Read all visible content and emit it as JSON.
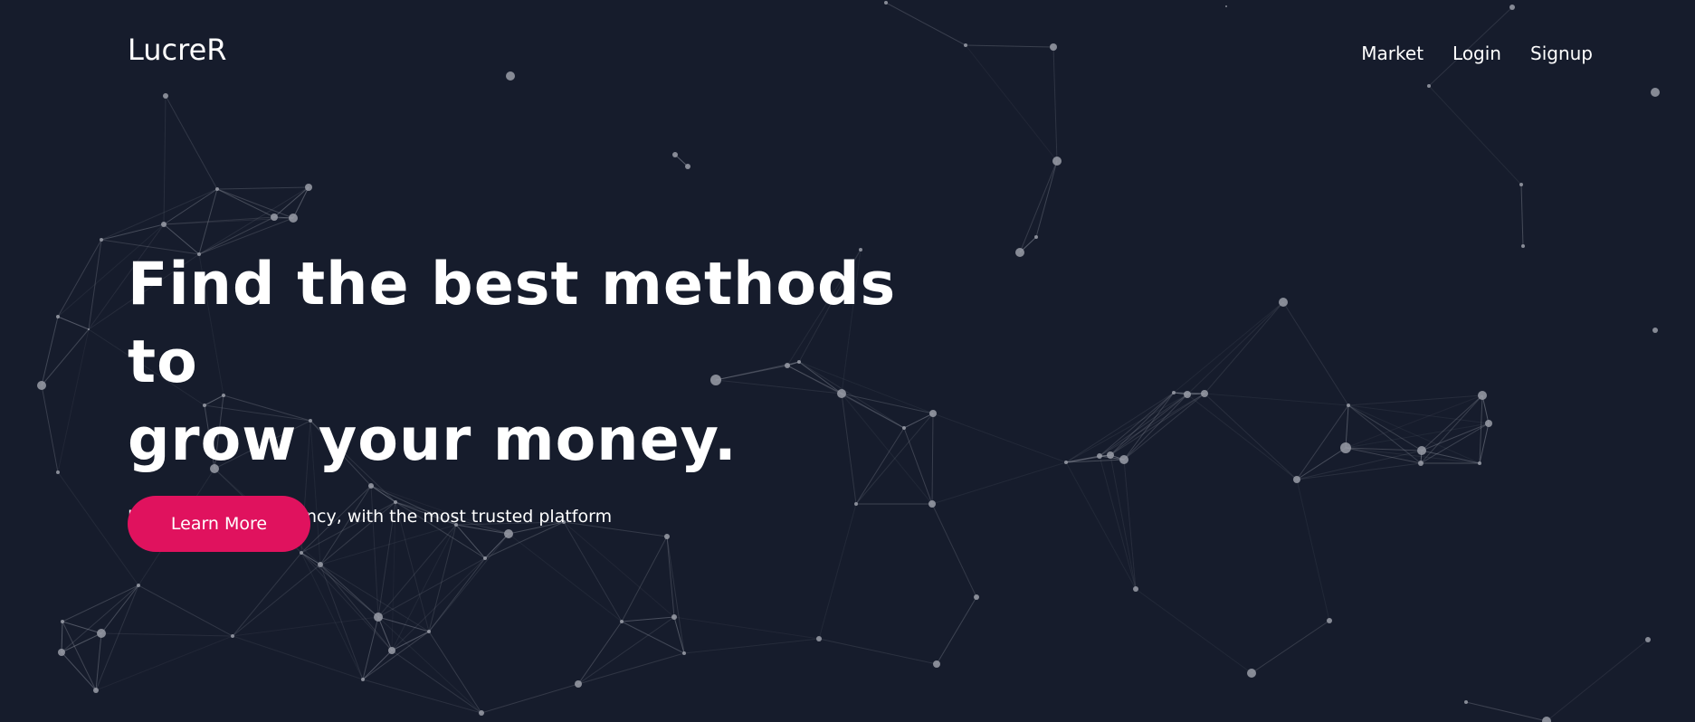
{
  "brand": {
    "name": "LucreR"
  },
  "nav": {
    "items": [
      {
        "label": "Market"
      },
      {
        "label": "Login"
      },
      {
        "label": "Signup"
      }
    ]
  },
  "hero": {
    "title_line1": "Find the best methods to",
    "title_line2": "grow your money.",
    "subtitle": "Invest in cryptocurrency, with the most trusted platform",
    "cta_label": "Learn More"
  },
  "colors": {
    "background": "#161c2c",
    "accent": "#e0125e",
    "text": "#ffffff",
    "network_line": "#8b909c",
    "network_node": "#9a9ea8"
  }
}
